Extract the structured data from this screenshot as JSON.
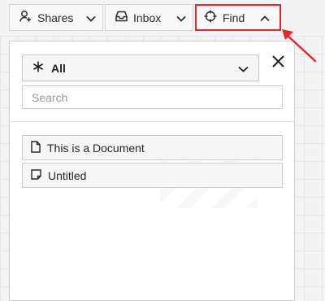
{
  "toolbar": {
    "shares": {
      "label": "Shares",
      "icon": "user-share-icon"
    },
    "inbox": {
      "label": "Inbox",
      "icon": "inbox-icon"
    },
    "find": {
      "label": "Find",
      "icon": "crosshair-icon",
      "highlight_color": "#e8262a"
    }
  },
  "find_panel": {
    "filter": {
      "selected": "All",
      "icon": "asterisk-icon"
    },
    "search": {
      "placeholder": "Search",
      "value": ""
    },
    "results": [
      {
        "label": "This is a Document",
        "icon": "document-icon"
      },
      {
        "label": "Untitled",
        "icon": "note-icon"
      }
    ]
  },
  "annotation": {
    "arrow_color": "#e8262a"
  }
}
